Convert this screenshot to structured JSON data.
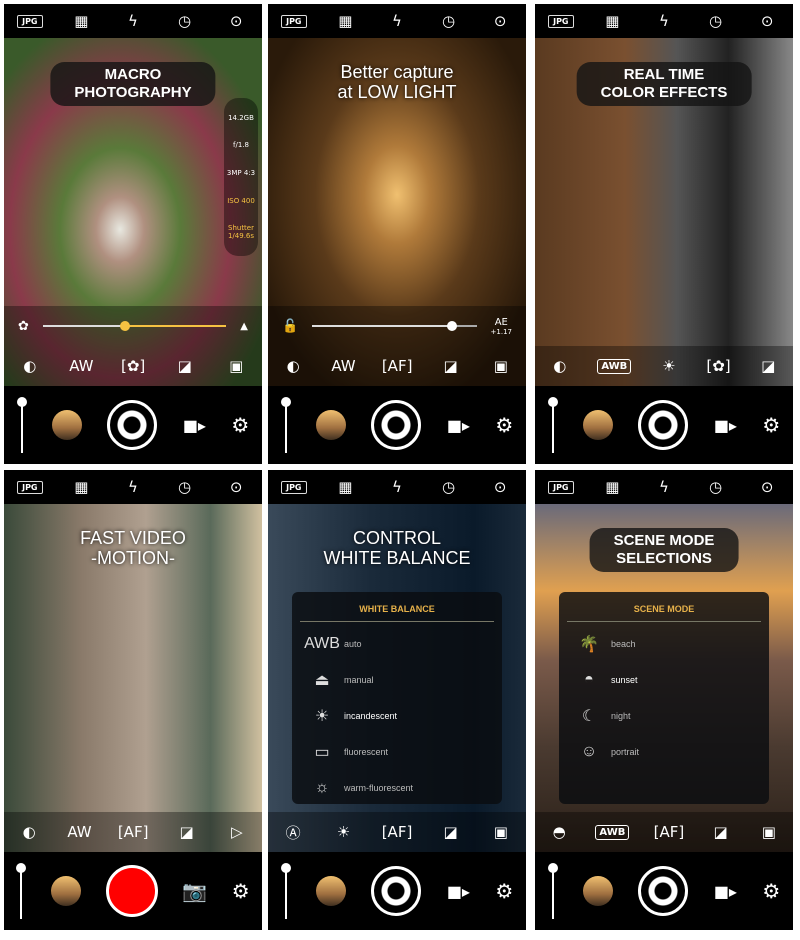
{
  "colors": {
    "accent": "#f5c242",
    "record": "#ff0000",
    "menu_title": "#e6b14a"
  },
  "panels": [
    {
      "caption": [
        "MACRO",
        "PHOTOGRAPHY"
      ],
      "caption_style": "pill",
      "bg": "radial-gradient(ellipse at 45% 55%,#e8e8e0 0,#b09080 12%,#5a7a3a 30%,#8a3a4a 55%,#3a5a2a 80%)",
      "info": [
        "14.2GB",
        "f/1.8",
        "3MP 4:3",
        "ISO 400",
        "Shutter 1/49.6s"
      ],
      "slider": {
        "left_icon": "macro-flower-icon",
        "left": "✿",
        "right": "▲",
        "right_icon": "landscape-icon",
        "value": 0.45,
        "knob": "#f5c242",
        "label": ""
      },
      "icons": [
        [
          "blend-icon",
          "◐"
        ],
        [
          "auto-white-balance-icon",
          "AW"
        ],
        [
          "focus-icon",
          "[✿]"
        ],
        [
          "exposure-icon",
          "◪"
        ],
        [
          "gallery-icon",
          "▣"
        ]
      ],
      "bottom": "photo"
    },
    {
      "caption": [
        "Better capture",
        "at LOW LIGHT"
      ],
      "caption_style": "plain",
      "bg": "radial-gradient(ellipse at 50% 45%,#f0c070 0,#b07a3a 18%,#5a3a1a 45%,#2a1a0a 80%)",
      "slider": {
        "left_icon": "unlock-icon",
        "left": "🔓",
        "right": "AE",
        "right_icon": "",
        "value": 0.85,
        "knob": "#fff",
        "label": "+1.17"
      },
      "icons": [
        [
          "blend-icon",
          "◐"
        ],
        [
          "auto-white-balance-icon",
          "AW"
        ],
        [
          "autofocus-icon",
          "[AF]"
        ],
        [
          "exposure-icon",
          "◪"
        ],
        [
          "gallery-icon",
          "▣"
        ]
      ],
      "bottom": "photo"
    },
    {
      "caption": [
        "REAL TIME",
        "COLOR EFFECTS"
      ],
      "caption_style": "pill",
      "bg": "linear-gradient(90deg,#5a3a20 0,#7a5030 35%,#555 55%,#222 75%,#888 100%)",
      "icons": [
        [
          "blend-icon",
          "◐"
        ],
        [
          "awb-icon",
          "AWB"
        ],
        [
          "incandescent-icon",
          "☀"
        ],
        [
          "focus-icon",
          "[✿]"
        ],
        [
          "exposure-icon",
          "◪"
        ]
      ],
      "bottom": "photo"
    },
    {
      "caption": [
        "FAST VIDEO",
        "-MOTION-"
      ],
      "caption_style": "plain",
      "bg": "linear-gradient(90deg,#3a4a3a,#8a7a6a 30%,#b0a090 55%,#5a6a5a 80%,#d0c0a0)",
      "icons": [
        [
          "blend-icon",
          "◐"
        ],
        [
          "auto-white-balance-icon",
          "AW"
        ],
        [
          "autofocus-icon",
          "[AF]"
        ],
        [
          "exposure-icon",
          "◪"
        ],
        [
          "play-icon",
          "▷"
        ]
      ],
      "bottom": "video"
    },
    {
      "caption": [
        "CONTROL",
        "WHITE BALANCE"
      ],
      "caption_style": "plain",
      "bg": "linear-gradient(90deg,#3a4a5a,#1a2a3a 40%,#0a1a2a 80%,#1a2a3a)",
      "menu": {
        "title": "WHITE BALANCE",
        "items": [
          [
            "awb-icon",
            "AWB",
            "auto"
          ],
          [
            "manual-icon",
            "⏏",
            "manual"
          ],
          [
            "incandescent-icon",
            "☀",
            "incandescent"
          ],
          [
            "fluorescent-icon",
            "▭",
            "fluorescent"
          ],
          [
            "warm-fluorescent-icon",
            "☼",
            "warm-fluorescent"
          ]
        ],
        "selected": 2
      },
      "icons": [
        [
          "auto-icon",
          "Ⓐ"
        ],
        [
          "incandescent-icon",
          "☀"
        ],
        [
          "autofocus-icon",
          "[AF]"
        ],
        [
          "exposure-icon",
          "◪"
        ],
        [
          "gallery-icon",
          "▣"
        ]
      ],
      "bottom": "photo"
    },
    {
      "caption": [
        "SCENE MODE",
        "SELECTIONS"
      ],
      "caption_style": "pill",
      "bg": "linear-gradient(180deg,#6a6a7a,#e0a050 25%,#7a5a4a 45%,#4a3a30 70%,#2a2018)",
      "menu": {
        "title": "SCENE MODE",
        "items": [
          [
            "beach-icon",
            "🌴",
            "beach"
          ],
          [
            "sunset-icon",
            "◓",
            "sunset"
          ],
          [
            "night-icon",
            "☾",
            "night"
          ],
          [
            "portrait-icon",
            "☺",
            "portrait"
          ]
        ],
        "selected": 1
      },
      "icons": [
        [
          "sunset-icon",
          "◓"
        ],
        [
          "awb-icon",
          "AWB"
        ],
        [
          "autofocus-icon",
          "[AF]"
        ],
        [
          "exposure-icon",
          "◪"
        ],
        [
          "gallery-icon",
          "▣"
        ]
      ],
      "bottom": "photo"
    }
  ],
  "topbar": [
    [
      "jpg-format-icon",
      "JPG"
    ],
    [
      "grid-off-icon",
      "▦"
    ],
    [
      "flash-auto-icon",
      "ϟ"
    ],
    [
      "timer-icon",
      "◷"
    ],
    [
      "camera-switch-icon",
      "⊙"
    ]
  ]
}
